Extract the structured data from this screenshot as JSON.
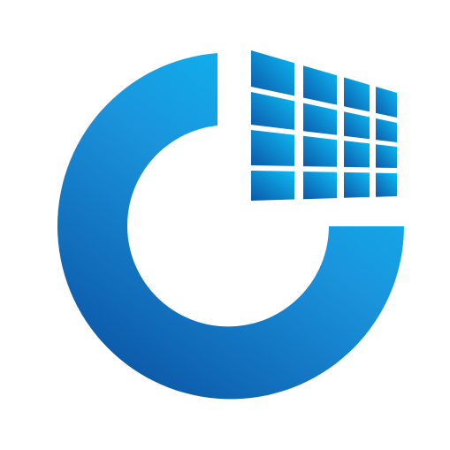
{
  "logo": {
    "icon": "app-logo-icon",
    "description_colors": {
      "gradient_light": "#0bbcf5",
      "gradient_mid": "#1a94dc",
      "gradient_dark": "#0c58a8",
      "background": "#ffffff"
    },
    "grid": {
      "rows": 4,
      "columns": 4
    }
  }
}
